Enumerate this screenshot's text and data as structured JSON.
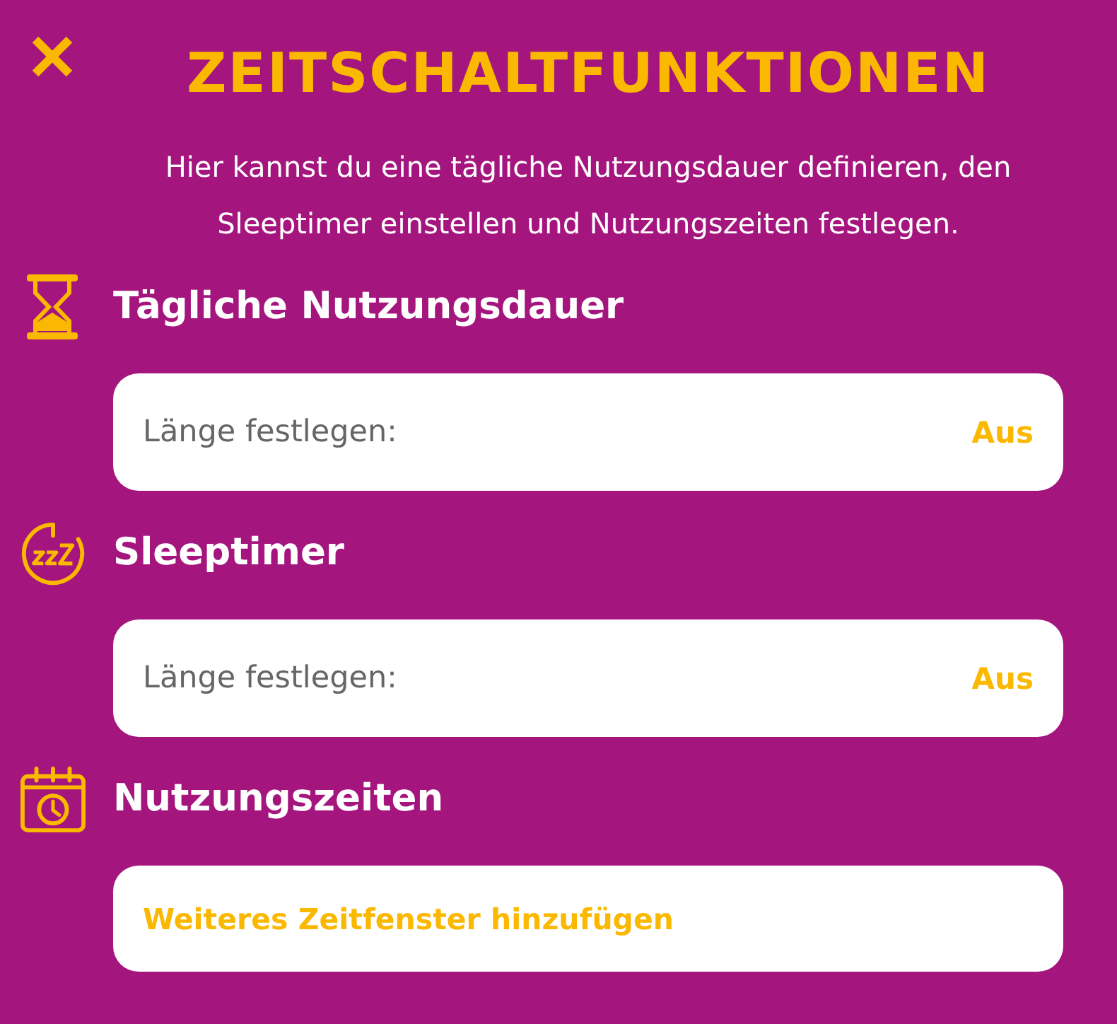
{
  "title": "ZEITSCHALTFUNKTIONEN",
  "description": "Hier kannst du eine tägliche Nutzungsdauer definieren, den Sleeptimer einstellen und Nutzungszeiten festlegen.",
  "sections": [
    {
      "heading": "Tägliche Nutzungsdauer",
      "row": {
        "kind": "setting",
        "label": "Länge festlegen:",
        "value": "Aus"
      }
    },
    {
      "heading": "Sleeptimer",
      "row": {
        "kind": "setting",
        "label": "Länge festlegen:",
        "value": "Aus"
      }
    },
    {
      "heading": "Nutzungszeiten",
      "row": {
        "kind": "action",
        "label": "Weiteres Zeitfenster hinzufügen"
      }
    }
  ]
}
